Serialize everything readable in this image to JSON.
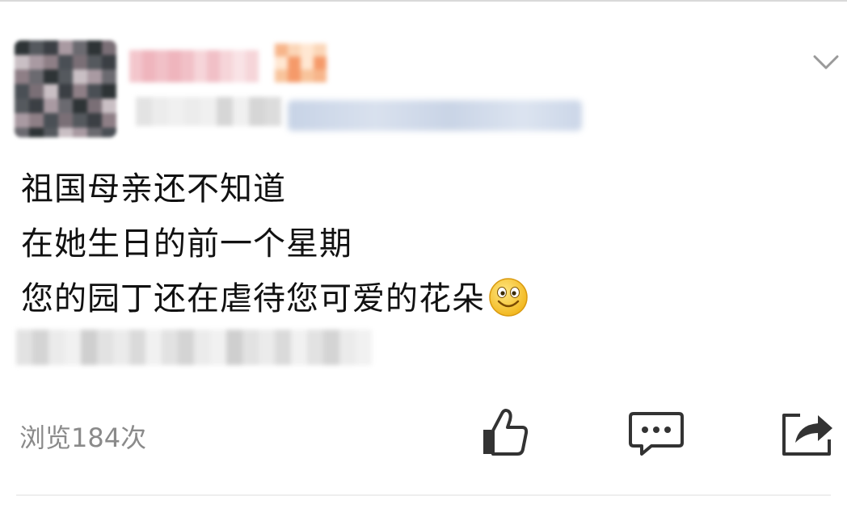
{
  "post": {
    "lines": [
      "祖国母亲还不知道",
      "在她生日的前一个星期",
      "您的园丁还在虐待您可爱的花朵"
    ],
    "emoji": "smile-emoji"
  },
  "footer": {
    "views_label": "浏览184次",
    "actions": [
      "thumbs-up-icon",
      "comment-icon",
      "share-icon"
    ]
  },
  "header": {
    "menu_icon": "chevron-down-icon"
  },
  "colors": {
    "text": "#111111",
    "muted": "#8a8a8a",
    "icon": "#333333",
    "emoji": "#f5c518"
  }
}
